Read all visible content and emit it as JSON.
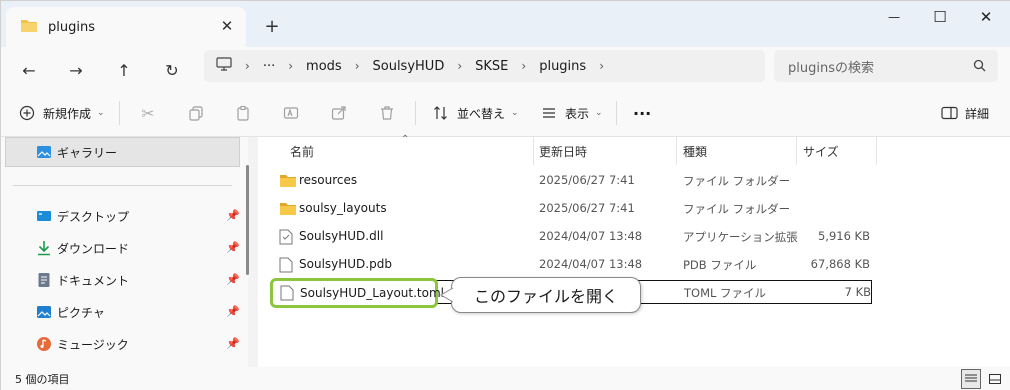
{
  "window": {
    "tab_title": "plugins",
    "tab_close": "✕",
    "new_tab": "+",
    "controls": {
      "minimize": "—",
      "maximize": "☐",
      "close": "✕"
    }
  },
  "nav": {
    "back": "←",
    "forward": "→",
    "up": "↑",
    "refresh": "↻"
  },
  "address": {
    "overflow": "···",
    "crumbs": [
      "mods",
      "SoulsyHUD",
      "SKSE",
      "plugins"
    ]
  },
  "search": {
    "placeholder": "pluginsの検索"
  },
  "commandbar": {
    "new_label": "新規作成",
    "sort_label": "並べ替え",
    "view_label": "表示",
    "more": "···",
    "details_label": "詳細"
  },
  "sidebar": {
    "gallery": "ギャラリー",
    "items": [
      {
        "label": "デスクトップ",
        "icon": "desktop-icon"
      },
      {
        "label": "ダウンロード",
        "icon": "download-icon"
      },
      {
        "label": "ドキュメント",
        "icon": "documents-icon"
      },
      {
        "label": "ピクチャ",
        "icon": "pictures-icon"
      },
      {
        "label": "ミュージック",
        "icon": "music-icon"
      }
    ]
  },
  "columns": {
    "name": "名前",
    "date": "更新日時",
    "type": "種類",
    "size": "サイズ"
  },
  "files": [
    {
      "name": "resources",
      "date": "2025/06/27 7:41",
      "type": "ファイル フォルダー",
      "size": "",
      "kind": "folder"
    },
    {
      "name": "soulsy_layouts",
      "date": "2025/06/27 7:41",
      "type": "ファイル フォルダー",
      "size": "",
      "kind": "folder"
    },
    {
      "name": "SoulsyHUD.dll",
      "date": "2024/04/07 13:48",
      "type": "アプリケーション拡張",
      "size": "5,916 KB",
      "kind": "dll"
    },
    {
      "name": "SoulsyHUD.pdb",
      "date": "2024/04/07 13:48",
      "type": "PDB ファイル",
      "size": "67,868 KB",
      "kind": "file"
    },
    {
      "name": "SoulsyHUD_Layout.toml",
      "date": "",
      "type": "TOML ファイル",
      "size": "7 KB",
      "kind": "file"
    }
  ],
  "callout": "このファイルを開く",
  "status": {
    "count": "5 個の項目"
  },
  "colors": {
    "highlight": "#8cc63f",
    "folder": "#f2c34b",
    "accent": "#0067c0"
  }
}
